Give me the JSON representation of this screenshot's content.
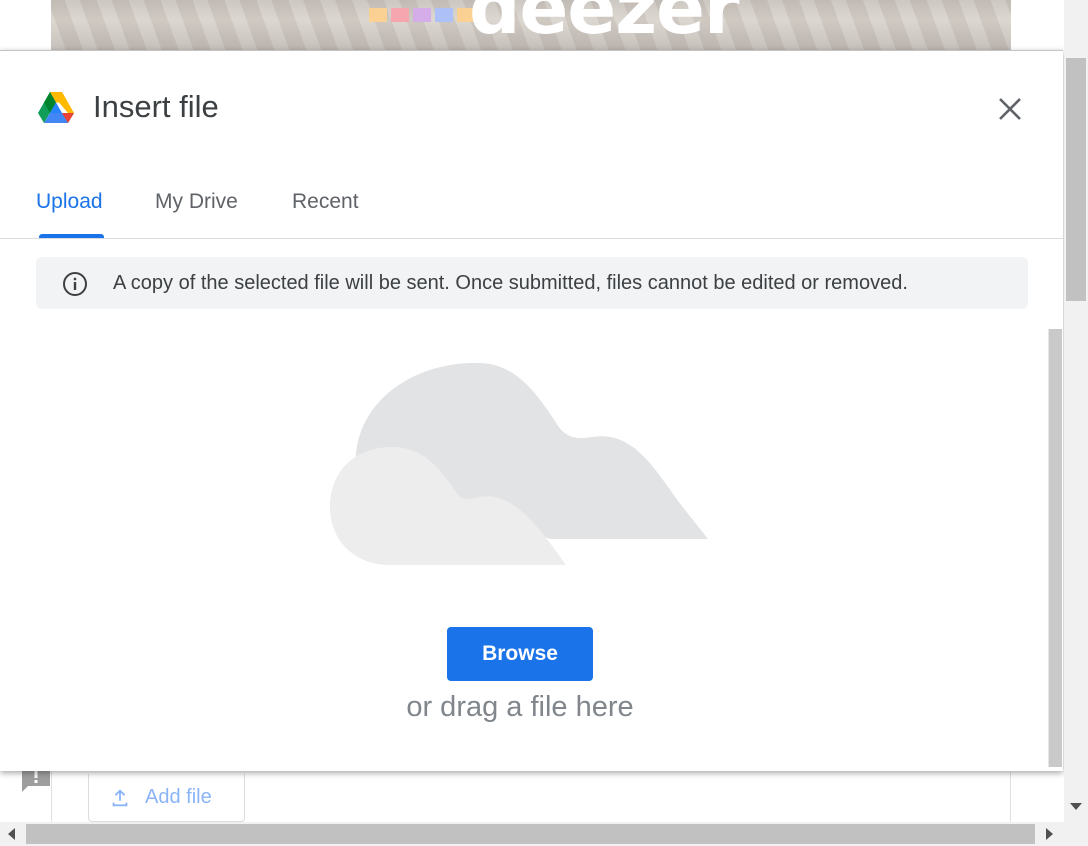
{
  "background": {
    "banner_logo_text": "deezer",
    "add_file_label": "Add file"
  },
  "dialog": {
    "title": "Insert file",
    "close_icon": "close-icon",
    "tabs": [
      {
        "label": "Upload",
        "active": true
      },
      {
        "label": "My Drive",
        "active": false
      },
      {
        "label": "Recent",
        "active": false
      }
    ],
    "notice": "A copy of the selected file will be sent. Once submitted, files cannot be edited or removed.",
    "browse_label": "Browse",
    "drag_text": "or drag a file here"
  },
  "colors": {
    "accent": "#1a73e8",
    "notice_bg": "#f1f3f4",
    "cloud": "#e2e3e5",
    "muted_text": "#80868b"
  }
}
